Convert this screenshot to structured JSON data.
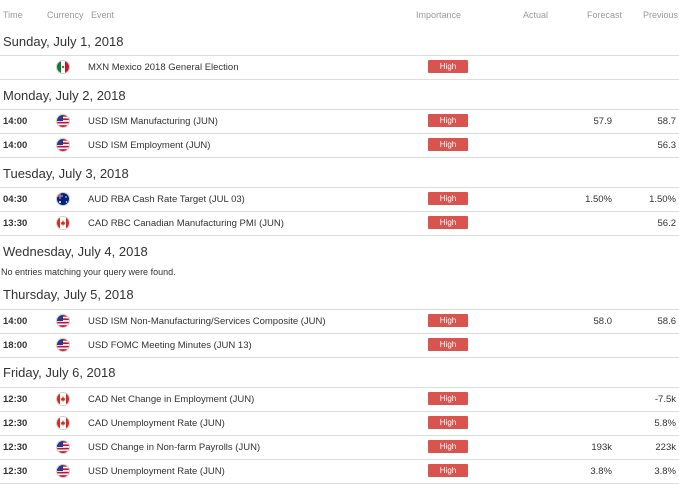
{
  "header": {
    "time": "Time",
    "currency": "Currency",
    "event": "Event",
    "importance": "Importance",
    "actual": "Actual",
    "forecast": "Forecast",
    "previous": "Previous"
  },
  "days": [
    {
      "title": "Sunday, July 1, 2018",
      "events": [
        {
          "time": "",
          "flag": "mexico-flag-icon",
          "event": "MXN Mexico 2018 General Election",
          "importance": "High",
          "actual": "",
          "forecast": "",
          "previous": ""
        }
      ]
    },
    {
      "title": "Monday, July 2, 2018",
      "events": [
        {
          "time": "14:00",
          "flag": "usa-flag-icon",
          "event": "USD ISM Manufacturing (JUN)",
          "importance": "High",
          "actual": "",
          "forecast": "57.9",
          "previous": "58.7"
        },
        {
          "time": "14:00",
          "flag": "usa-flag-icon",
          "event": "USD ISM Employment (JUN)",
          "importance": "High",
          "actual": "",
          "forecast": "",
          "previous": "56.3"
        }
      ]
    },
    {
      "title": "Tuesday, July 3, 2018",
      "events": [
        {
          "time": "04:30",
          "flag": "australia-flag-icon",
          "event": "AUD RBA Cash Rate Target (JUL 03)",
          "importance": "High",
          "actual": "",
          "forecast": "1.50%",
          "previous": "1.50%"
        },
        {
          "time": "13:30",
          "flag": "canada-flag-icon",
          "event": "CAD RBC Canadian Manufacturing PMI (JUN)",
          "importance": "High",
          "actual": "",
          "forecast": "",
          "previous": "56.2"
        }
      ]
    },
    {
      "title": "Wednesday, July 4, 2018",
      "no_entries": "No entries matching your query were found.",
      "events": []
    },
    {
      "title": "Thursday, July 5, 2018",
      "events": [
        {
          "time": "14:00",
          "flag": "usa-flag-icon",
          "event": "USD ISM Non-Manufacturing/Services Composite (JUN)",
          "importance": "High",
          "actual": "",
          "forecast": "58.0",
          "previous": "58.6"
        },
        {
          "time": "18:00",
          "flag": "usa-flag-icon",
          "event": "USD FOMC Meeting Minutes (JUN 13)",
          "importance": "High",
          "actual": "",
          "forecast": "",
          "previous": ""
        }
      ]
    },
    {
      "title": "Friday, July 6, 2018",
      "events": [
        {
          "time": "12:30",
          "flag": "canada-flag-icon",
          "event": "CAD Net Change in Employment (JUN)",
          "importance": "High",
          "actual": "",
          "forecast": "",
          "previous": "-7.5k"
        },
        {
          "time": "12:30",
          "flag": "canada-flag-icon",
          "event": "CAD Unemployment Rate (JUN)",
          "importance": "High",
          "actual": "",
          "forecast": "",
          "previous": "5.8%"
        },
        {
          "time": "12:30",
          "flag": "usa-flag-icon",
          "event": "USD Change in Non-farm Payrolls (JUN)",
          "importance": "High",
          "actual": "",
          "forecast": "193k",
          "previous": "223k"
        },
        {
          "time": "12:30",
          "flag": "usa-flag-icon",
          "event": "USD Unemployment Rate (JUN)",
          "importance": "High",
          "actual": "",
          "forecast": "3.8%",
          "previous": "3.8%"
        }
      ]
    }
  ],
  "colors": {
    "importance_high": "#d9534f",
    "row_border": "#dddddd",
    "header_text": "#9a9a9a"
  }
}
